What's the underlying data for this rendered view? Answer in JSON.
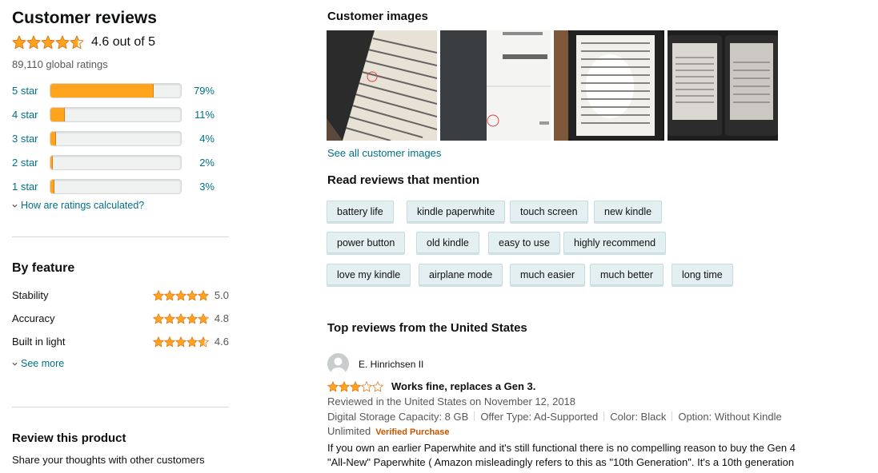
{
  "summary": {
    "title": "Customer reviews",
    "average_text": "4.6 out of 5",
    "average_rating": 4.6,
    "global_ratings": "89,110 global ratings",
    "star_color": "#ffa41c",
    "histogram": [
      {
        "label": "5 star",
        "percent_text": "79%",
        "percent": 79
      },
      {
        "label": "4 star",
        "percent_text": "11%",
        "percent": 11
      },
      {
        "label": "3 star",
        "percent_text": "4%",
        "percent": 4
      },
      {
        "label": "2 star",
        "percent_text": "2%",
        "percent": 2
      },
      {
        "label": "1 star",
        "percent_text": "3%",
        "percent": 3
      }
    ],
    "how_calculated": "How are ratings calculated?"
  },
  "features": {
    "title": "By feature",
    "items": [
      {
        "name": "Stability",
        "value": "5.0",
        "rating": 5.0
      },
      {
        "name": "Accuracy",
        "value": "4.8",
        "rating": 4.8
      },
      {
        "name": "Built in light",
        "value": "4.6",
        "rating": 4.6
      }
    ],
    "see_more": "See more"
  },
  "review_product": {
    "title": "Review this product",
    "subtitle": "Share your thoughts with other customers"
  },
  "customer_images": {
    "title": "Customer images",
    "see_all": "See all customer images"
  },
  "mentions": {
    "title": "Read reviews that mention",
    "chips": [
      "battery life",
      "kindle paperwhite",
      "touch screen",
      "new kindle",
      "power button",
      "old kindle",
      "easy to use",
      "highly recommend",
      "love my kindle",
      "airplane mode",
      "much easier",
      "much better",
      "long time"
    ]
  },
  "top_reviews": {
    "title": "Top reviews from the United States",
    "review": {
      "reviewer": "E. Hinrichsen II",
      "rating": 3,
      "title": "Works fine, replaces a Gen 3.",
      "date": "Reviewed in the United States on November 12, 2018",
      "meta": [
        "Digital Storage Capacity: 8 GB",
        "Offer Type: Ad-Supported",
        "Color: Black",
        "Option: Without Kindle"
      ],
      "meta_cont": "Unlimited",
      "verified": "Verified Purchase",
      "body": "If you own an earlier Paperwhite and it's still functional there is no compelling reason to buy the Gen 4 \"All-New\" Paperwhite ( Amazon misleadingly refers to this as \"10th Generation\". It's a 10th generation"
    }
  }
}
